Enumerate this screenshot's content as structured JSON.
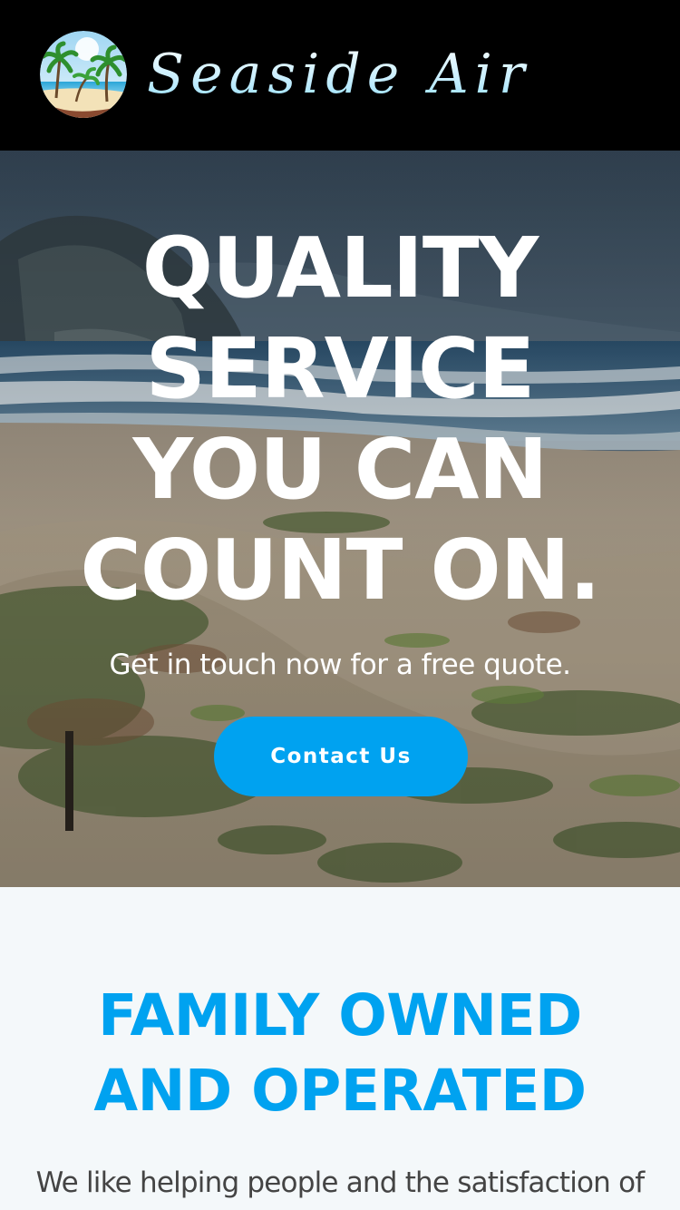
{
  "header": {
    "logo_text": "Seaside Air",
    "logo_icon": "palm-beach-icon"
  },
  "hero": {
    "title_lines": [
      "QUALITY",
      "SERVICE",
      "YOU CAN",
      "COUNT ON."
    ],
    "subtitle": "Get in touch now for a free quote.",
    "cta_label": "Contact Us"
  },
  "about": {
    "title_lines": [
      "FAMILY OWNED",
      "AND OPERATED"
    ],
    "text": "We like helping people and the satisfaction of"
  },
  "colors": {
    "header_bg": "#000000",
    "accent": "#00a2f0",
    "hero_text": "#ffffff",
    "section_bg": "#f4f8fa",
    "body_text": "#444444"
  }
}
